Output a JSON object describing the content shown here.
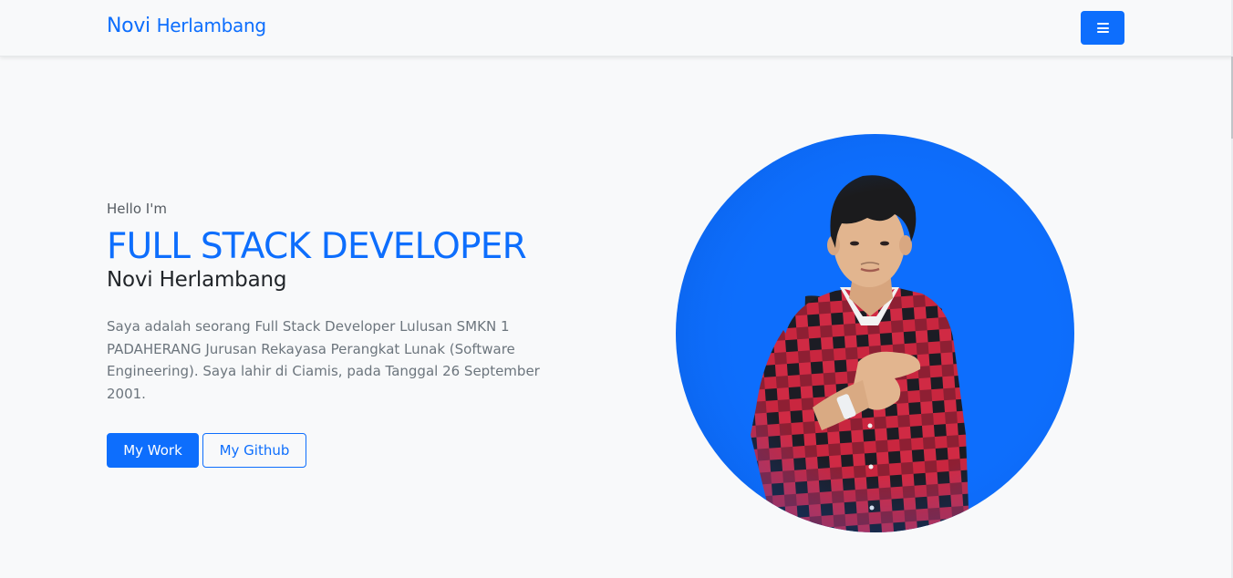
{
  "navbar": {
    "brand_first": "Novi",
    "brand_last": "Herlambang",
    "menu_icon": "hamburger-menu-icon"
  },
  "hero": {
    "greeting": "Hello I'm",
    "role": "FULL STACK DEVELOPER",
    "name": "Novi Herlambang",
    "bio": "Saya adalah seorang Full Stack Developer Lulusan SMKN 1 PADAHERANG Jurusan Rekayasa Perangkat Lunak (Software Engineering). Saya lahir di Ciamis, pada Tanggal 26 September 2001.",
    "buttons": {
      "work": "My Work",
      "github": "My Github"
    }
  },
  "colors": {
    "primary": "#0d6efd",
    "background": "#f8f9fa",
    "shirt_red": "#e6334d",
    "shirt_dark": "#1c1c24",
    "skin": "#e2b58f",
    "hair": "#1b1b1d"
  }
}
